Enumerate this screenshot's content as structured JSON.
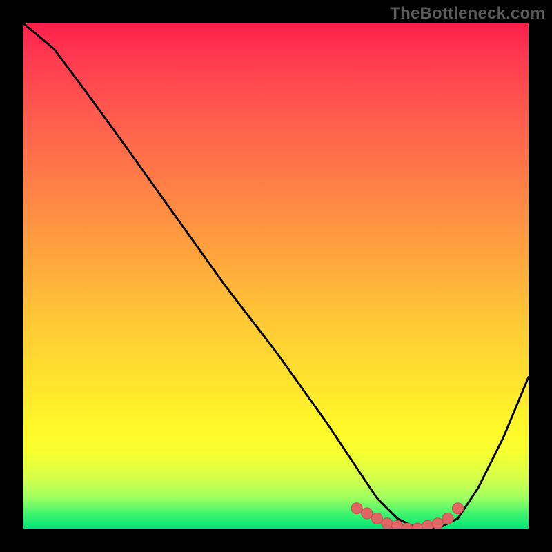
{
  "watermark": "TheBottleneck.com",
  "colors": {
    "frame": "#000000",
    "curve_stroke": "#000000",
    "marker_fill": "#e06666",
    "marker_stroke": "#c74f4f"
  },
  "chart_data": {
    "type": "line",
    "title": "",
    "xlabel": "",
    "ylabel": "",
    "xlim": [
      0,
      100
    ],
    "ylim": [
      0,
      100
    ],
    "grid": false,
    "series": [
      {
        "name": "curve",
        "x": [
          0,
          6,
          12,
          20,
          30,
          40,
          50,
          60,
          66,
          70,
          74,
          78,
          82,
          86,
          90,
          95,
          100
        ],
        "values": [
          100,
          95,
          87,
          76,
          62,
          48,
          35,
          21,
          12,
          6,
          2,
          0,
          0,
          2,
          8,
          18,
          30
        ]
      }
    ],
    "markers": {
      "name": "optimal-range",
      "x": [
        66,
        68,
        70,
        72,
        74,
        76,
        78,
        80,
        82,
        84,
        86
      ],
      "values": [
        4,
        3,
        2,
        1,
        0.5,
        0,
        0,
        0.5,
        1,
        2,
        4
      ]
    }
  }
}
